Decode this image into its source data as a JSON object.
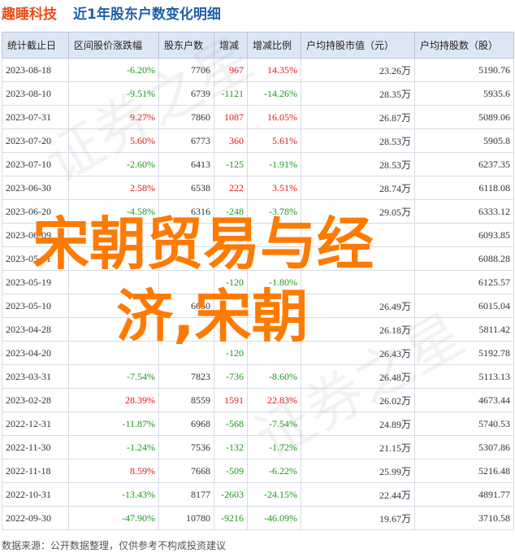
{
  "title": {
    "company": "趣睡科技",
    "subtitle": "近1年股东户数变化明细"
  },
  "columns": [
    "统计截止日",
    "区间股价涨跌幅",
    "股东户数",
    "增减",
    "增减比例",
    "户均持股市值（元）",
    "户均持股数（股）"
  ],
  "rows": [
    {
      "date": "2023-08-18",
      "change": "-6.20%",
      "holders": "7706",
      "delta": "967",
      "ratio": "14.35%",
      "avg_value": "23.26万",
      "avg_shares": "5190.76",
      "change_up": false,
      "delta_up": true
    },
    {
      "date": "2023-08-10",
      "change": "-9.51%",
      "holders": "6739",
      "delta": "-1121",
      "ratio": "-14.26%",
      "avg_value": "28.35万",
      "avg_shares": "5935.6",
      "change_up": false,
      "delta_up": false
    },
    {
      "date": "2023-07-31",
      "change": "9.27%",
      "holders": "7860",
      "delta": "1087",
      "ratio": "16.05%",
      "avg_value": "26.87万",
      "avg_shares": "5089.06",
      "change_up": true,
      "delta_up": true
    },
    {
      "date": "2023-07-20",
      "change": "5.60%",
      "holders": "6773",
      "delta": "360",
      "ratio": "5.61%",
      "avg_value": "28.53万",
      "avg_shares": "5905.8",
      "change_up": true,
      "delta_up": true
    },
    {
      "date": "2023-07-10",
      "change": "-2.60%",
      "holders": "6413",
      "delta": "-125",
      "ratio": "-1.91%",
      "avg_value": "28.53万",
      "avg_shares": "6237.35",
      "change_up": false,
      "delta_up": false
    },
    {
      "date": "2023-06-30",
      "change": "2.58%",
      "holders": "6538",
      "delta": "222",
      "ratio": "3.51%",
      "avg_value": "28.74万",
      "avg_shares": "6118.08",
      "change_up": true,
      "delta_up": true
    },
    {
      "date": "2023-06-20",
      "change": "-4.58%",
      "holders": "6316",
      "delta": "-248",
      "ratio": "-3.78%",
      "avg_value": "29.05万",
      "avg_shares": "6333.12",
      "change_up": false,
      "delta_up": false
    },
    {
      "date": "2023-06-09",
      "change": "",
      "holders": "",
      "delta": "",
      "ratio": "",
      "avg_value": "",
      "avg_shares": "6093.85",
      "change_up": false,
      "delta_up": false
    },
    {
      "date": "2023-05-31",
      "change": "",
      "holders": "",
      "delta": "",
      "ratio": "",
      "avg_value": "",
      "avg_shares": "6088.28",
      "change_up": false,
      "delta_up": false
    },
    {
      "date": "2023-05-19",
      "change": "",
      "holders": "",
      "delta": "-120",
      "ratio": "-1.80%",
      "avg_value": "",
      "avg_shares": "6125.57",
      "change_up": false,
      "delta_up": false
    },
    {
      "date": "2023-05-10",
      "change": "",
      "holders": "6650",
      "delta": "",
      "ratio": "",
      "avg_value": "26.49万",
      "avg_shares": "6015.04",
      "change_up": false,
      "delta_up": false
    },
    {
      "date": "2023-04-28",
      "change": "",
      "holders": "",
      "delta": "",
      "ratio": "",
      "avg_value": "26.18万",
      "avg_shares": "5811.42",
      "change_up": false,
      "delta_up": false
    },
    {
      "date": "2023-04-20",
      "change": "",
      "holders": "",
      "delta": "-120",
      "ratio": "",
      "avg_value": "26.43万",
      "avg_shares": "5192.78",
      "change_up": false,
      "delta_up": false
    },
    {
      "date": "2023-03-31",
      "change": "-7.54%",
      "holders": "7823",
      "delta": "-736",
      "ratio": "-8.60%",
      "avg_value": "26.48万",
      "avg_shares": "5113.13",
      "change_up": false,
      "delta_up": false
    },
    {
      "date": "2023-02-28",
      "change": "28.39%",
      "holders": "8559",
      "delta": "1591",
      "ratio": "22.83%",
      "avg_value": "26.02万",
      "avg_shares": "4673.44",
      "change_up": true,
      "delta_up": true
    },
    {
      "date": "2022-12-31",
      "change": "-11.87%",
      "holders": "6968",
      "delta": "-568",
      "ratio": "-7.54%",
      "avg_value": "24.89万",
      "avg_shares": "5740.53",
      "change_up": false,
      "delta_up": false
    },
    {
      "date": "2022-11-30",
      "change": "-1.24%",
      "holders": "7536",
      "delta": "-132",
      "ratio": "-1.72%",
      "avg_value": "21.15万",
      "avg_shares": "5307.86",
      "change_up": false,
      "delta_up": false
    },
    {
      "date": "2022-11-18",
      "change": "8.59%",
      "holders": "7668",
      "delta": "-509",
      "ratio": "-6.22%",
      "avg_value": "25.99万",
      "avg_shares": "5216.48",
      "change_up": true,
      "delta_up": false
    },
    {
      "date": "2022-10-31",
      "change": "-13.43%",
      "holders": "8177",
      "delta": "-2603",
      "ratio": "-24.15%",
      "avg_value": "22.44万",
      "avg_shares": "4891.77",
      "change_up": false,
      "delta_up": false
    },
    {
      "date": "2022-09-30",
      "change": "-47.90%",
      "holders": "10780",
      "delta": "-9216",
      "ratio": "-46.09%",
      "avg_value": "19.67万",
      "avg_shares": "3710.58",
      "change_up": false,
      "delta_up": false
    }
  ],
  "footer": "数据来源：公开数据整理，仅供参考不构成投资建议",
  "overlay": {
    "line1": "宋朝贸易与经",
    "line2": "济,宋朝"
  },
  "colors": {
    "up": "#e0191b",
    "down": "#1a9a1a",
    "header_bg": "#dde7f4",
    "title_company": "#e94e17",
    "title_rest": "#1e5fa8",
    "overlay": "#ff7a00"
  }
}
